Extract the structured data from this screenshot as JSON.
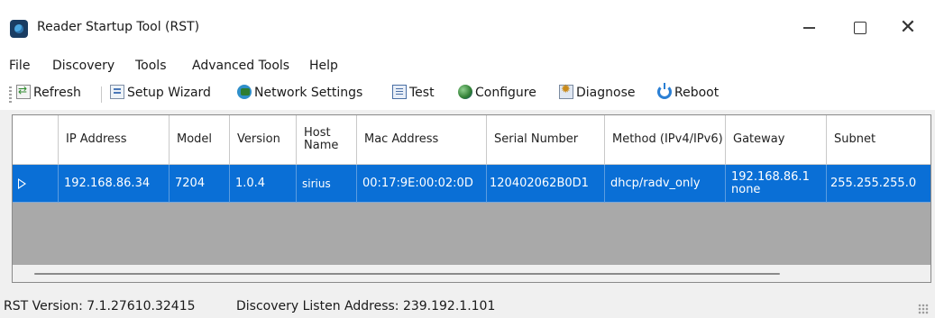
{
  "window": {
    "title": "Reader Startup Tool (RST)",
    "controls": {
      "minimize": "—",
      "maximize": "",
      "close": "✕"
    }
  },
  "menu": [
    "File",
    "Discovery",
    "Tools",
    "Advanced Tools",
    "Help"
  ],
  "toolbar": {
    "refresh": "Refresh",
    "setup_wizard": "Setup Wizard",
    "network_settings": "Network Settings",
    "test": "Test",
    "configure": "Configure",
    "diagnose": "Diagnose",
    "reboot": "Reboot"
  },
  "table": {
    "columns": [
      {
        "label": "IP Address"
      },
      {
        "label": "Model"
      },
      {
        "label": "Version"
      },
      {
        "label": "Host Name"
      },
      {
        "label": "Mac Address"
      },
      {
        "label": "Serial Number"
      },
      {
        "label": "Method (IPv4/IPv6)"
      },
      {
        "label": "Gateway"
      },
      {
        "label": "Subnet"
      }
    ],
    "rows": [
      {
        "selected": true,
        "ip_address": "192.168.86.34",
        "model": "7204",
        "version": "1.0.4",
        "host_name": "sirius",
        "mac_address": "00:17:9E:00:02:0D",
        "serial_number": "120402062B0D1",
        "method": "dhcp/radv_only",
        "gateway_line1": "192.168.86.1",
        "gateway_line2": "none",
        "subnet": "255.255.255.0"
      }
    ]
  },
  "status": {
    "rst_version": "RST Version: 7.1.27610.32415",
    "discovery_listen": "Discovery Listen Address: 239.192.1.101"
  },
  "colors": {
    "selection": "#0a6fd6",
    "grid_background": "#a9a9a9",
    "window_background": "#f0f0f0"
  }
}
